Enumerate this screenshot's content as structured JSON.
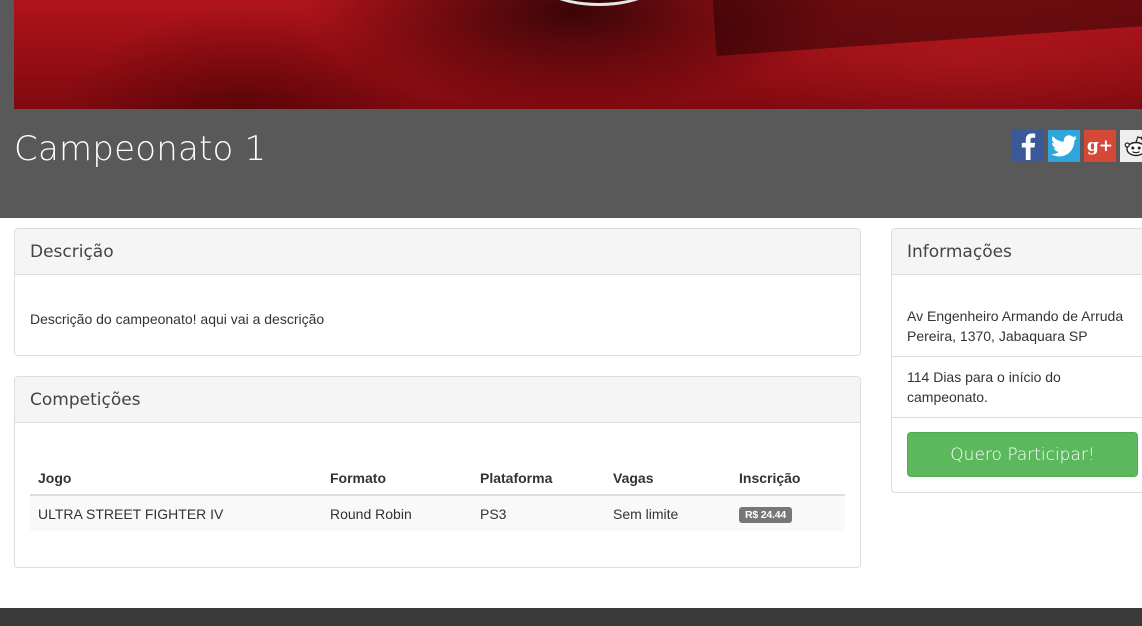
{
  "page": {
    "title": "Campeonato 1"
  },
  "share": {
    "items": [
      {
        "name": "facebook",
        "icon": "facebook-icon",
        "color": "#3b5998"
      },
      {
        "name": "twitter",
        "icon": "twitter-icon",
        "color": "#2ea6dd"
      },
      {
        "name": "google",
        "icon": "google-plus-icon",
        "label": "g+",
        "color": "#d34836"
      },
      {
        "name": "reddit",
        "icon": "reddit-icon",
        "color": "#eeeeee"
      }
    ]
  },
  "descricao": {
    "heading": "Descrição",
    "text": "Descrição do campeonato! aqui vai a descrição"
  },
  "competicoes": {
    "heading": "Competições",
    "columns": [
      "Jogo",
      "Formato",
      "Plataforma",
      "Vagas",
      "Inscrição"
    ],
    "rows": [
      {
        "jogo": "ULTRA STREET FIGHTER IV",
        "formato": "Round Robin",
        "plataforma": "PS3",
        "vagas": "Sem limite",
        "inscricao": "R$ 24.44"
      }
    ]
  },
  "informacoes": {
    "heading": "Informações",
    "address": "Av Engenheiro Armando de Arruda Pereira, 1370, Jabaquara SP",
    "countdown": "114 Dias para o início do campeonato.",
    "button_label": "Quero Participar!"
  },
  "colors": {
    "header_band": "#595959",
    "banner_red": "#b0141b",
    "success_green": "#5cb85c",
    "badge_gray": "#777777"
  }
}
